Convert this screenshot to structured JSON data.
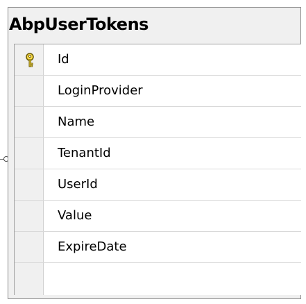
{
  "table": {
    "title": "AbpUserTokens",
    "primary_key_icon": "key-icon",
    "columns": [
      {
        "name": "Id",
        "is_primary_key": true
      },
      {
        "name": "LoginProvider",
        "is_primary_key": false
      },
      {
        "name": "Name",
        "is_primary_key": false
      },
      {
        "name": "TenantId",
        "is_primary_key": false
      },
      {
        "name": "UserId",
        "is_primary_key": false
      },
      {
        "name": "Value",
        "is_primary_key": false
      },
      {
        "name": "ExpireDate",
        "is_primary_key": false
      }
    ]
  },
  "relationship": {
    "end_icon": "relationship-circle-icon"
  },
  "colors": {
    "box_border": "#8a8a8a",
    "header_background": "#f0f0f0",
    "grid_background": "#ffffff",
    "key_fill": "#f5d84a"
  }
}
